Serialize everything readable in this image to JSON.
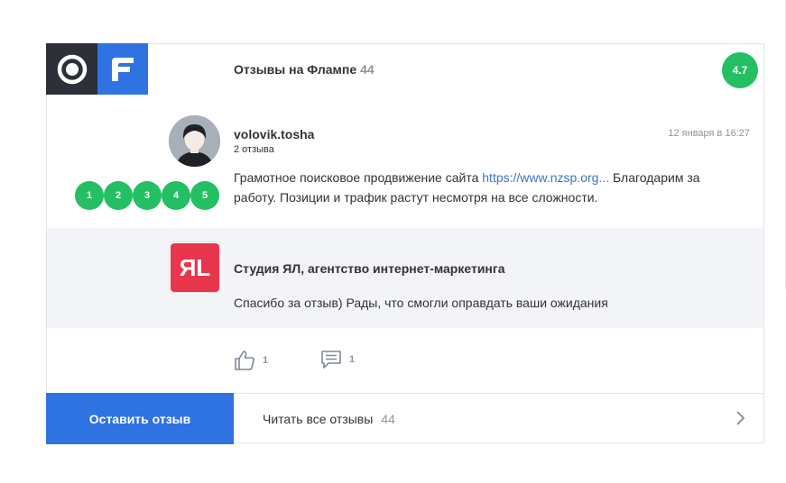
{
  "header": {
    "title": "Отзывы на Флампе",
    "count": "44",
    "rating": "4.7"
  },
  "review": {
    "author": "volovik.tosha",
    "author_meta": "2 отзыва",
    "date": "12 января в 16:27",
    "text_before": "Грамотное поисковое продвижение сайта ",
    "link_text": "https://www.nzsp.org...",
    "text_after": " Благодарим за работу. Позиции и трафик растут несмотря на все сложности.",
    "stars": [
      "1",
      "2",
      "3",
      "4",
      "5"
    ]
  },
  "reply": {
    "logo_text": "ЯL",
    "name": "Студия ЯЛ, агентство интернет-маркетинга",
    "text": "Спасибо за отзыв) Рады, что смогли оправдать ваши ожидания"
  },
  "actions": {
    "likes": "1",
    "comments": "1"
  },
  "footer": {
    "leave_review": "Оставить отзыв",
    "read_all": "Читать все отзывы",
    "read_all_count": "44"
  },
  "colors": {
    "accent_blue": "#2f72e2",
    "green": "#24bf62",
    "dark": "#2c3039",
    "reply_red": "#e8364d"
  }
}
